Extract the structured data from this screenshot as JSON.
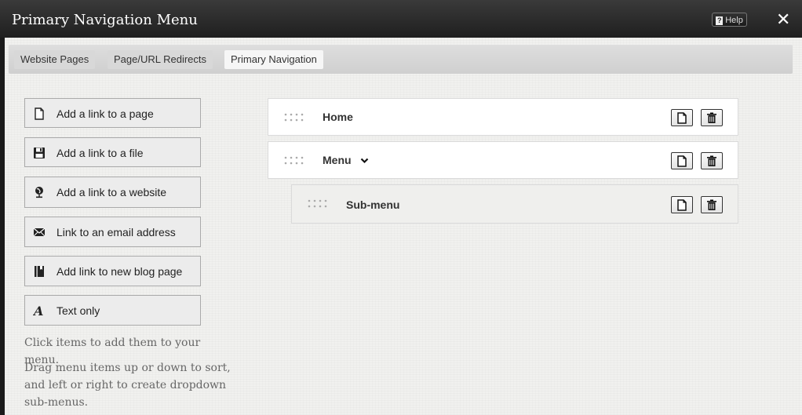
{
  "window": {
    "title": "Primary Navigation Menu",
    "help_label": "Help",
    "close_glyph": "✕"
  },
  "tabs": [
    {
      "label": "Website Pages",
      "active": false
    },
    {
      "label": "Page/URL Redirects",
      "active": false
    },
    {
      "label": "Primary Navigation",
      "active": true
    }
  ],
  "add_buttons": [
    {
      "label": "Add a link to a page",
      "icon": "page-icon"
    },
    {
      "label": "Add a link to a file",
      "icon": "floppy-disk-icon"
    },
    {
      "label": "Add a link to a website",
      "icon": "globe-icon"
    },
    {
      "label": "Link to an email address",
      "icon": "envelope-icon"
    },
    {
      "label": "Add link to new blog page",
      "icon": "book-icon"
    },
    {
      "label": "Text only",
      "icon": "text-icon"
    }
  ],
  "hints": {
    "click": "Click items to add them to your menu.",
    "drag": "Drag menu items up or down to sort, and left or right to create dropdown sub-menus."
  },
  "menu_items": [
    {
      "label": "Home",
      "level": 0,
      "has_dropdown": false
    },
    {
      "label": "Menu",
      "level": 0,
      "has_dropdown": true
    },
    {
      "label": "Sub-menu",
      "level": 1,
      "has_dropdown": false
    }
  ]
}
